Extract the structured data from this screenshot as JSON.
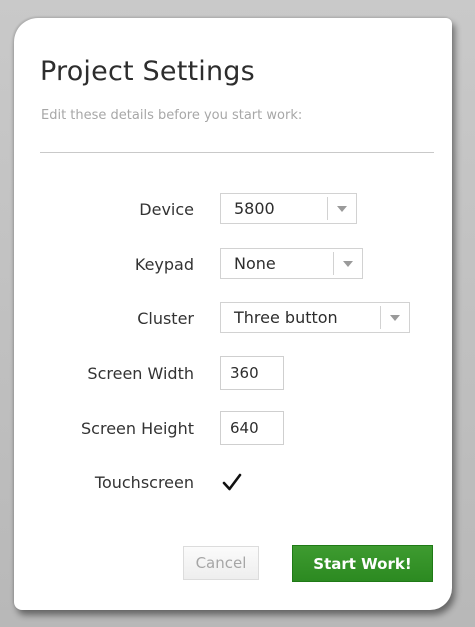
{
  "dialog": {
    "title": "Project Settings",
    "subtitle": "Edit these details before you start work:"
  },
  "fields": {
    "device": {
      "label": "Device",
      "value": "5800"
    },
    "keypad": {
      "label": "Keypad",
      "value": "None"
    },
    "cluster": {
      "label": "Cluster",
      "value": "Three button"
    },
    "screen_width": {
      "label": "Screen Width",
      "value": "360"
    },
    "screen_height": {
      "label": "Screen Height",
      "value": "640"
    },
    "touchscreen": {
      "label": "Touchscreen",
      "checked": true
    }
  },
  "buttons": {
    "cancel_label": "Cancel",
    "start_label": "Start Work!"
  },
  "colors": {
    "accent_green": "#2f8f24",
    "backdrop": "#b9b9b9",
    "disabled_text": "#a6a6a6"
  },
  "icons": {
    "dropdown": "chevron-down-icon",
    "checkmark": "checkmark-icon"
  }
}
